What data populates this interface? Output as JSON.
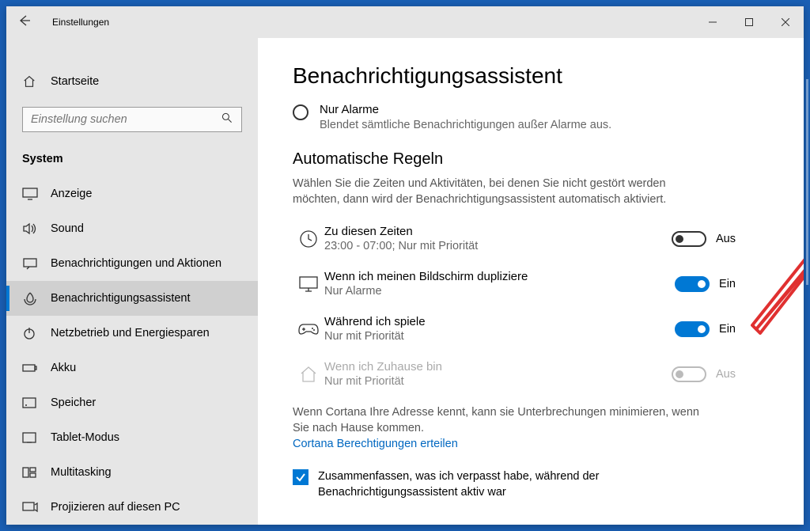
{
  "titlebar": {
    "back_icon": "back-arrow",
    "title": "Einstellungen"
  },
  "sidebar": {
    "home_label": "Startseite",
    "search_placeholder": "Einstellung suchen",
    "section_label": "System",
    "items": [
      {
        "icon": "display",
        "label": "Anzeige"
      },
      {
        "icon": "sound",
        "label": "Sound"
      },
      {
        "icon": "notifications",
        "label": "Benachrichtigungen und Aktionen"
      },
      {
        "icon": "focus-assist",
        "label": "Benachrichtigungsassistent",
        "active": true
      },
      {
        "icon": "power",
        "label": "Netzbetrieb und Energiesparen"
      },
      {
        "icon": "battery",
        "label": "Akku"
      },
      {
        "icon": "storage",
        "label": "Speicher"
      },
      {
        "icon": "tablet",
        "label": "Tablet-Modus"
      },
      {
        "icon": "multitask",
        "label": "Multitasking"
      },
      {
        "icon": "project",
        "label": "Projizieren auf diesen PC"
      }
    ]
  },
  "content": {
    "page_title": "Benachrichtigungsassistent",
    "radio": {
      "label": "Nur Alarme",
      "desc": "Blendet sämtliche Benachrichtigungen außer Alarme aus."
    },
    "subheading": "Automatische Regeln",
    "subdesc": "Wählen Sie die Zeiten und Aktivitäten, bei denen Sie nicht gestört werden möchten, dann wird der Benachrichtigungsassistent automatisch aktiviert.",
    "rules": [
      {
        "icon": "clock",
        "label": "Zu diesen Zeiten",
        "desc": "23:00 - 07:00; Nur mit Priorität",
        "toggle": "off",
        "toggle_label": "Aus"
      },
      {
        "icon": "monitor",
        "label": "Wenn ich meinen Bildschirm dupliziere",
        "desc": "Nur Alarme",
        "toggle": "on",
        "toggle_label": "Ein"
      },
      {
        "icon": "game",
        "label": "Während ich spiele",
        "desc": "Nur mit Priorität",
        "toggle": "on",
        "toggle_label": "Ein"
      },
      {
        "icon": "home",
        "label": "Wenn ich Zuhause bin",
        "desc": "Nur mit Priorität",
        "toggle": "disabled",
        "toggle_label": "Aus",
        "disabled": true
      }
    ],
    "cortana_note": "Wenn Cortana Ihre Adresse kennt, kann sie Unterbrechungen minimieren, wenn Sie nach Hause kommen.",
    "cortana_link": "Cortana Berechtigungen erteilen",
    "checkbox_label": "Zusammenfassen, was ich verpasst habe, während der Benachrichtigungsassistent aktiv war"
  }
}
